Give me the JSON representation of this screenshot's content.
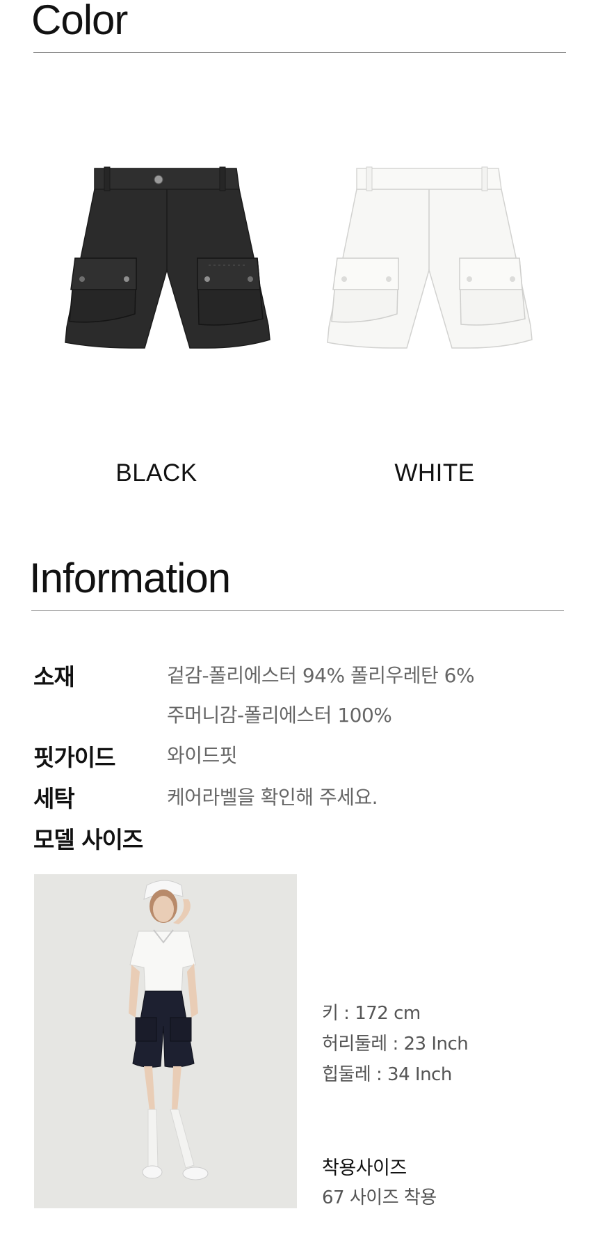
{
  "color_section": {
    "title": "Color",
    "swatches": [
      {
        "label": "BLACK",
        "product_color": "#2b2b2b"
      },
      {
        "label": "WHITE",
        "product_color": "#f7f7f5"
      }
    ]
  },
  "info_section": {
    "title": "Information",
    "rows": [
      {
        "label": "소재",
        "value": "겉감-폴리에스터 94% 폴리우레탄 6%"
      },
      {
        "label": "",
        "value": "주머니감-폴리에스터 100%"
      },
      {
        "label": "핏가이드",
        "value": "와이드핏"
      },
      {
        "label": "세탁",
        "value": "케어라벨을 확인해 주세요."
      },
      {
        "label": "모델 사이즈",
        "value": ""
      }
    ]
  },
  "model": {
    "specs": [
      "키 : 172 cm",
      "허리둘레 : 23 Inch",
      "힙둘레 : 34 Inch"
    ],
    "fit_heading": "착용사이즈",
    "fit_value": "67 사이즈 착용"
  }
}
